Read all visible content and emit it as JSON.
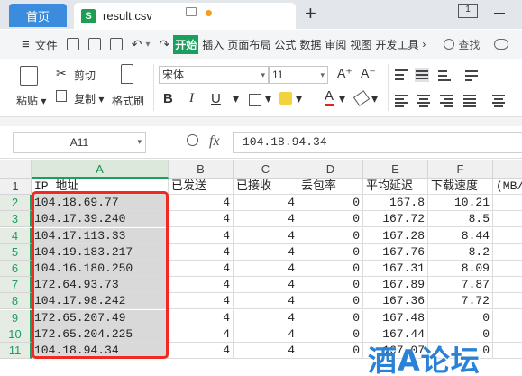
{
  "tabbar": {
    "home_label": "首页",
    "file_icon": "S",
    "file_name": "result.csv",
    "add_symbol": "+",
    "window_ctrl_label": "1"
  },
  "menu": {
    "hamburger": "≡",
    "file": "文件",
    "tabs": [
      "开始",
      "插入",
      "页面布局",
      "公式",
      "数据",
      "审阅",
      "视图",
      "开发工具"
    ],
    "chevron": "›",
    "search": "查找"
  },
  "toolbar": {
    "paste": "粘贴",
    "cut": "剪切",
    "copy": "复制",
    "format_painter": "格式刷",
    "font_name": "宋体",
    "font_size": "11",
    "grow_font": "A⁺",
    "shrink_font": "A⁻",
    "bold": "B",
    "italic": "I",
    "underline": "U",
    "font_color": "A",
    "dropdown_arrow": "▾"
  },
  "formula_bar": {
    "cell_ref": "A11",
    "fx": "fx",
    "content": "104.18.94.34"
  },
  "grid": {
    "columns": [
      "A",
      "B",
      "C",
      "D",
      "E",
      "F"
    ],
    "rows": [
      "1",
      "2",
      "3",
      "4",
      "5",
      "6",
      "7",
      "8",
      "9",
      "10",
      "11"
    ],
    "header": [
      "IP 地址",
      "已发送",
      "已接收",
      "丢包率",
      "平均延迟",
      "下载速度",
      "(MB/s)"
    ],
    "data": [
      [
        "104.18.69.77",
        "4",
        "4",
        "0",
        "167.8",
        "10.21"
      ],
      [
        "104.17.39.240",
        "4",
        "4",
        "0",
        "167.72",
        "8.5"
      ],
      [
        "104.17.113.33",
        "4",
        "4",
        "0",
        "167.28",
        "8.44"
      ],
      [
        "104.19.183.217",
        "4",
        "4",
        "0",
        "167.76",
        "8.2"
      ],
      [
        "104.16.180.250",
        "4",
        "4",
        "0",
        "167.31",
        "8.09"
      ],
      [
        "172.64.93.73",
        "4",
        "4",
        "0",
        "167.89",
        "7.87"
      ],
      [
        "104.17.98.242",
        "4",
        "4",
        "0",
        "167.36",
        "7.72"
      ],
      [
        "172.65.207.49",
        "4",
        "4",
        "0",
        "167.48",
        "0"
      ],
      [
        "172.65.204.225",
        "4",
        "4",
        "0",
        "167.44",
        "0"
      ],
      [
        "104.18.94.34",
        "4",
        "4",
        "0",
        "167.07",
        "0"
      ]
    ]
  },
  "watermark": "酒A论坛",
  "colors": {
    "accent_green": "#1a9f5f",
    "tab_blue": "#3b8cdd",
    "highlight_red": "#ee2a22",
    "watermark_blue": "#2a82d6"
  }
}
